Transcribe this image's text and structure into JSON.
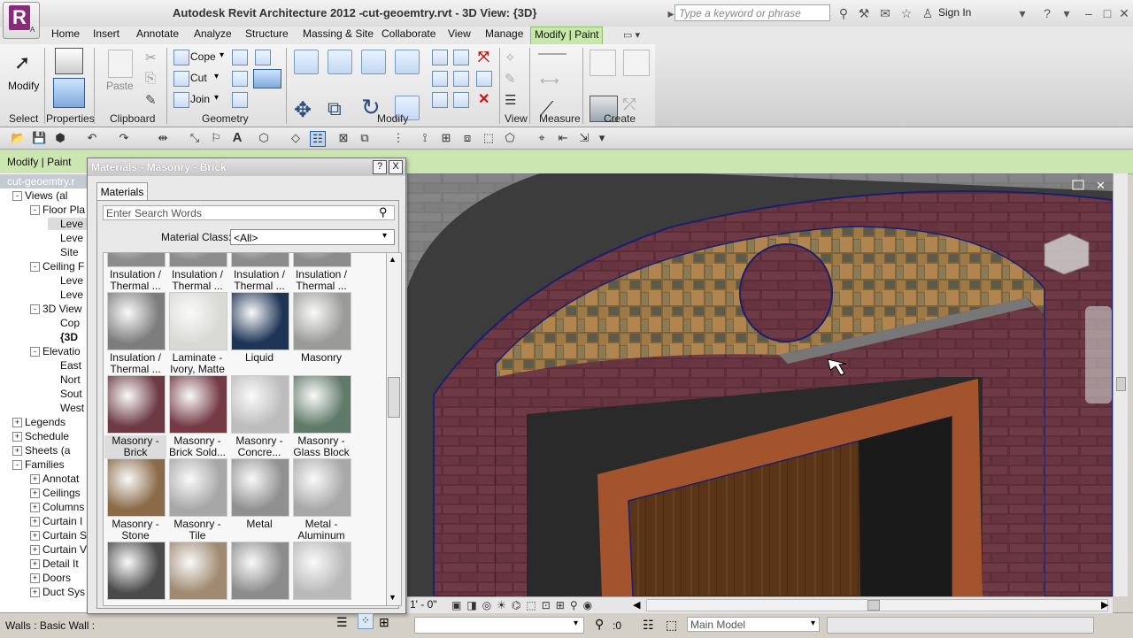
{
  "app": {
    "title": "Autodesk Revit Architecture 2012 -",
    "document": "cut-geoemtry.rvt - 3D View: {3D}",
    "logo_letter": "R",
    "logo_sub": "A",
    "search_placeholder": "Type a keyword or phrase",
    "sign_in": "Sign In"
  },
  "tabs": [
    "Home",
    "Insert",
    "Annotate",
    "Analyze",
    "Structure",
    "Massing & Site",
    "Collaborate",
    "View",
    "Manage",
    "Modify | Paint"
  ],
  "ribbon": {
    "select": {
      "title": "Select",
      "modify_label": "Modify"
    },
    "properties": {
      "title": "Properties"
    },
    "clipboard": {
      "title": "Clipboard",
      "paste_label": "Paste"
    },
    "geometry": {
      "title": "Geometry",
      "cope": "Cope",
      "cut": "Cut",
      "join": "Join"
    },
    "modify": {
      "title": "Modify"
    },
    "view": {
      "title": "View"
    },
    "measure": {
      "title": "Measure"
    },
    "create": {
      "title": "Create"
    }
  },
  "options_bar": {
    "label": "Modify | Paint"
  },
  "project_browser": {
    "header": "cut-geoemtry.r",
    "items": [
      {
        "label": "Views (al",
        "indent": 0,
        "box": "-"
      },
      {
        "label": "Floor Pla",
        "indent": 1,
        "box": "-"
      },
      {
        "label": "Leve",
        "indent": 2,
        "box": "",
        "selected": true
      },
      {
        "label": "Leve",
        "indent": 2,
        "box": ""
      },
      {
        "label": "Site",
        "indent": 2,
        "box": ""
      },
      {
        "label": "Ceiling F",
        "indent": 1,
        "box": "-"
      },
      {
        "label": "Leve",
        "indent": 2,
        "box": ""
      },
      {
        "label": "Leve",
        "indent": 2,
        "box": ""
      },
      {
        "label": "3D View",
        "indent": 1,
        "box": "-"
      },
      {
        "label": "Cop",
        "indent": 2,
        "box": ""
      },
      {
        "label": "{3D",
        "indent": 2,
        "box": "",
        "bold": true
      },
      {
        "label": "Elevatio",
        "indent": 1,
        "box": "-"
      },
      {
        "label": "East",
        "indent": 2,
        "box": ""
      },
      {
        "label": "Nort",
        "indent": 2,
        "box": ""
      },
      {
        "label": "Sout",
        "indent": 2,
        "box": ""
      },
      {
        "label": "West",
        "indent": 2,
        "box": ""
      },
      {
        "label": "Legends",
        "indent": 0,
        "box": "+"
      },
      {
        "label": "Schedule",
        "indent": 0,
        "box": "+"
      },
      {
        "label": "Sheets (a",
        "indent": 0,
        "box": "+"
      },
      {
        "label": "Families",
        "indent": 0,
        "box": "-"
      },
      {
        "label": "Annotat",
        "indent": 1,
        "box": "+"
      },
      {
        "label": "Ceilings",
        "indent": 1,
        "box": "+"
      },
      {
        "label": "Columns",
        "indent": 1,
        "box": "+"
      },
      {
        "label": "Curtain I",
        "indent": 1,
        "box": "+"
      },
      {
        "label": "Curtain S",
        "indent": 1,
        "box": "+"
      },
      {
        "label": "Curtain V",
        "indent": 1,
        "box": "+"
      },
      {
        "label": "Detail It",
        "indent": 1,
        "box": "+"
      },
      {
        "label": "Doors",
        "indent": 1,
        "box": "+"
      },
      {
        "label": "Duct Sys",
        "indent": 1,
        "box": "+"
      }
    ]
  },
  "materials_dialog": {
    "title": "Materials - Masonry - Brick",
    "help": "?",
    "close": "X",
    "tab": "Materials",
    "search_placeholder": "Enter Search Words",
    "class_label": "Material Class:",
    "class_value": "<All>",
    "swatches": [
      {
        "label": "Insulation / Thermal ...",
        "color": "#8c8c8c"
      },
      {
        "label": "Insulation / Thermal ...",
        "color": "#8c8c8c"
      },
      {
        "label": "Insulation / Thermal ...",
        "color": "#8c8c8c"
      },
      {
        "label": "Insulation / Thermal ...",
        "color": "#8c8c8c"
      },
      {
        "label": "Insulation / Thermal ...",
        "color": "#7d7d7d"
      },
      {
        "label": "Laminate - Ivory, Matte",
        "color": "#d9d9d6"
      },
      {
        "label": "Liquid",
        "color": "#1e3556"
      },
      {
        "label": "Masonry",
        "color": "#9a9a98"
      },
      {
        "label": "Masonry - Brick",
        "color": "#6d3a44",
        "selected": true
      },
      {
        "label": "Masonry - Brick Sold...",
        "color": "#743b45"
      },
      {
        "label": "Masonry - Concre...",
        "color": "#bdbdbd"
      },
      {
        "label": "Masonry - Glass Block",
        "color": "#5f7a68"
      },
      {
        "label": "Masonry - Stone",
        "color": "#8a6a48"
      },
      {
        "label": "Masonry - Tile",
        "color": "#a7a7a7"
      },
      {
        "label": "Metal",
        "color": "#909090"
      },
      {
        "label": "Metal - Aluminum",
        "color": "#a8a8a8"
      },
      {
        "label": "",
        "color": "#4a4a4a"
      },
      {
        "label": "",
        "color": "#a08a72"
      },
      {
        "label": "",
        "color": "#8c8c8c"
      },
      {
        "label": "",
        "color": "#b9b9b9"
      }
    ]
  },
  "viewport": {
    "scale": "1' - 0\"",
    "select_count": ":0",
    "model": "Main Model"
  },
  "status": {
    "text": "Walls : Basic Wall :"
  },
  "colors": {
    "brick": "#5e2e38",
    "stone": "#8a6a3c",
    "door_frame": "#a3542c",
    "door": "#5a3417",
    "option_bar": "#cbe6b1",
    "active_tab": "#c7e9a7"
  }
}
